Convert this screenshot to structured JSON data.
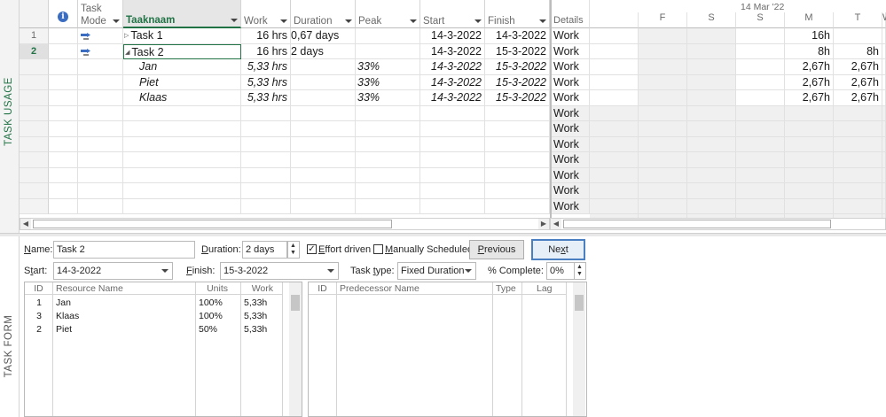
{
  "top_view_label": "TASK USAGE",
  "bottom_view_label": "TASK FORM",
  "columns": {
    "info_icon": "info-icon",
    "task_mode_line1": "Task",
    "task_mode_line2": "Mode",
    "name": "Taaknaam",
    "work": "Work",
    "duration": "Duration",
    "peak": "Peak",
    "start": "Start",
    "finish": "Finish"
  },
  "rows": [
    {
      "num": "1",
      "name": "Task 1",
      "work": "16 hrs",
      "duration": "0,67 days",
      "peak": "",
      "start": "14-3-2022",
      "finish": "14-3-2022",
      "detail": "Work",
      "ts": [
        "",
        "",
        "",
        "",
        "16h",
        "",
        ""
      ],
      "expander": "▷"
    },
    {
      "num": "2",
      "name": "Task 2",
      "work": "16 hrs",
      "duration": "2 days",
      "peak": "",
      "start": "14-3-2022",
      "finish": "15-3-2022",
      "detail": "Work",
      "ts": [
        "",
        "",
        "",
        "",
        "8h",
        "8h",
        ""
      ],
      "expander": "◢"
    },
    {
      "num": "",
      "name": "Jan",
      "work": "5,33 hrs",
      "duration": "",
      "peak": "33%",
      "start": "14-3-2022",
      "finish": "15-3-2022",
      "detail": "Work",
      "ts": [
        "",
        "",
        "",
        "",
        "2,67h",
        "2,67h",
        ""
      ]
    },
    {
      "num": "",
      "name": "Piet",
      "work": "5,33 hrs",
      "duration": "",
      "peak": "33%",
      "start": "14-3-2022",
      "finish": "15-3-2022",
      "detail": "Work",
      "ts": [
        "",
        "",
        "",
        "",
        "2,67h",
        "2,67h",
        ""
      ]
    },
    {
      "num": "",
      "name": "Klaas",
      "work": "5,33 hrs",
      "duration": "",
      "peak": "33%",
      "start": "14-3-2022",
      "finish": "15-3-2022",
      "detail": "Work",
      "ts": [
        "",
        "",
        "",
        "",
        "2,67h",
        "2,67h",
        ""
      ]
    }
  ],
  "details_header": "Details",
  "empty_detail": "Work",
  "timescale": {
    "week_label": "14 Mar '22",
    "days": [
      "F",
      "S",
      "S",
      "M",
      "T",
      "W"
    ]
  },
  "form": {
    "name_label": "Name:",
    "name_value": "Task 2",
    "duration_label": "Duration:",
    "duration_value": "2 days",
    "effort_driven_label": "Effort driven",
    "effort_driven_checked": true,
    "manually_scheduled_label": "Manually Scheduled",
    "manually_scheduled_checked": false,
    "previous_label": "Previous",
    "next_label": "Next",
    "start_label": "Start:",
    "start_value": "14-3-2022",
    "finish_label": "Finish:",
    "finish_value": "15-3-2022",
    "task_type_label": "Task type:",
    "task_type_value": "Fixed Duration",
    "pct_complete_label": "% Complete:",
    "pct_complete_value": "0%"
  },
  "resources": {
    "headers": {
      "id": "ID",
      "name": "Resource Name",
      "units": "Units",
      "work": "Work"
    },
    "rows": [
      {
        "id": "1",
        "name": "Jan",
        "units": "100%",
        "work": "5,33h"
      },
      {
        "id": "3",
        "name": "Klaas",
        "units": "100%",
        "work": "5,33h"
      },
      {
        "id": "2",
        "name": "Piet",
        "units": "50%",
        "work": "5,33h"
      }
    ]
  },
  "predecessors": {
    "headers": {
      "id": "ID",
      "name": "Predecessor Name",
      "type": "Type",
      "lag": "Lag"
    }
  },
  "colors": {
    "accent_green": "#217346",
    "selection": "#e6e6e6",
    "weekend_shade": "#f0f0f0"
  }
}
